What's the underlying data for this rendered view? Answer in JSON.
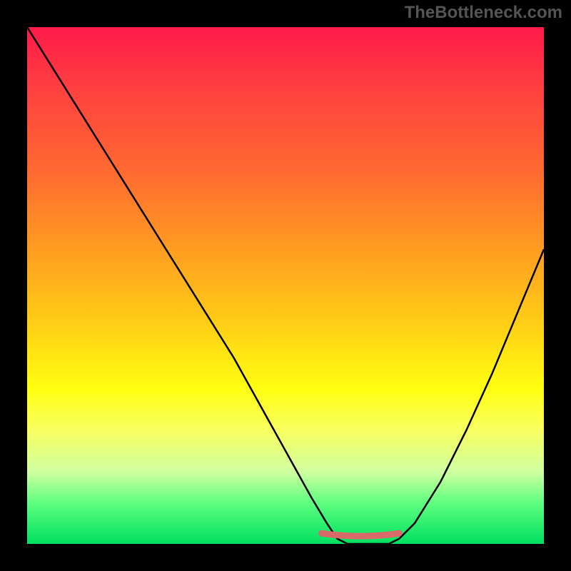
{
  "watermark": "TheBottleneck.com",
  "chart_data": {
    "type": "line",
    "title": "",
    "xlabel": "",
    "ylabel": "",
    "xlim": [
      0,
      100
    ],
    "ylim": [
      0,
      100
    ],
    "x": [
      0,
      5,
      10,
      15,
      20,
      25,
      30,
      35,
      40,
      45,
      50,
      55,
      58,
      60,
      62,
      65,
      68,
      70,
      72,
      75,
      80,
      85,
      90,
      95,
      100
    ],
    "y_bottleneck": [
      100,
      92,
      84,
      76,
      68,
      60,
      52,
      44,
      36,
      27,
      18,
      9,
      4,
      1,
      0,
      0,
      0,
      0,
      1,
      4,
      12,
      22,
      33,
      45,
      57
    ],
    "notch": {
      "x_start": 57,
      "x_end": 72,
      "y": 1.5,
      "color": "#d86a6a"
    }
  },
  "colors": {
    "gradient_top": "#ff1a4a",
    "gradient_bottom": "#00e060",
    "curve": "#000000",
    "border": "#000000",
    "notch": "#d86a6a"
  }
}
